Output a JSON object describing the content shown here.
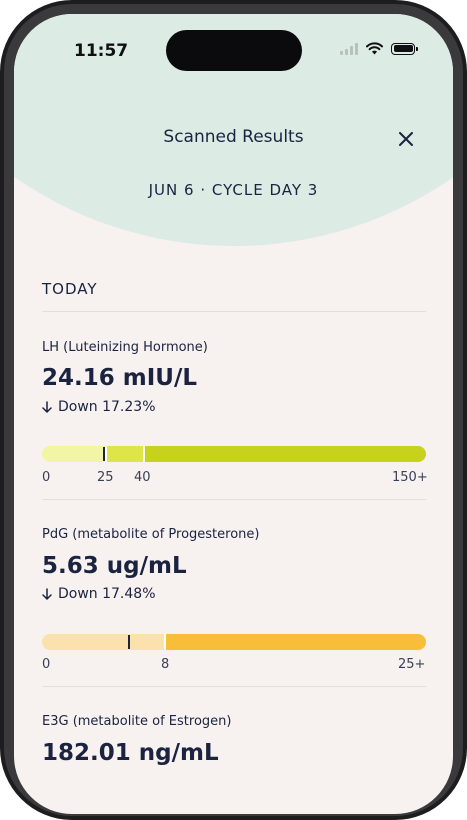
{
  "status": {
    "time": "11:57"
  },
  "header": {
    "title": "Scanned Results",
    "subtitle": "JUN 6 · CYCLE DAY 3"
  },
  "section": {
    "label": "TODAY"
  },
  "metrics": [
    {
      "name": "LH (Luteinizing Hormone)",
      "value": "24.16 mIU/L",
      "change": "Down 17.23%",
      "scale_labels": [
        "0",
        "25",
        "40",
        "150+"
      ],
      "marker_value": 24.16,
      "colors": {
        "low": "#f2f5a4",
        "mid": "#dde54a",
        "high": "#c6d21b"
      }
    },
    {
      "name": "PdG (metabolite of Progesterone)",
      "value": "5.63 ug/mL",
      "change": "Down 17.48%",
      "scale_labels": [
        "0",
        "8",
        "25+"
      ],
      "marker_value": 5.63,
      "colors": {
        "low": "#fbe1ab",
        "high": "#f8be3a"
      }
    },
    {
      "name": "E3G (metabolite of Estrogen)",
      "value": "182.01 ng/mL"
    }
  ]
}
